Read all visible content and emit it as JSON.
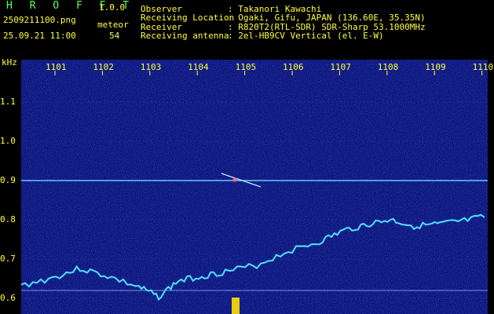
{
  "app": {
    "title": "H R O F F T",
    "version": "1.0.0",
    "filename": "2509211100.png",
    "datetime": "25.09.21 11:00",
    "meteor_label": "meteor",
    "meteor_count": "54"
  },
  "station": {
    "rows": [
      {
        "label": "Observer",
        "value": ": Takanori Kawachi"
      },
      {
        "label": "Receiving Location",
        "value": ": Ogaki, Gifu, JAPAN (136.60E, 35.35N)"
      },
      {
        "label": "Receiver",
        "value": ": R820T2(RTL-SDR) SDR-Sharp 53.1000MHz"
      },
      {
        "label": "Receiving antenna",
        "value": ": 2el-HB9CV Vertical (el. E-W)"
      }
    ]
  },
  "spectrogram": {
    "y_unit": "kHz",
    "y_ticks": [
      "1.1",
      "1.0",
      "0.9",
      "0.8",
      "0.7",
      "0.6"
    ],
    "x_ticks": [
      "1101",
      "1102",
      "1103",
      "1104",
      "1105",
      "1106",
      "1107",
      "1108",
      "1109",
      "1110"
    ],
    "colors": {
      "background": "#0a0f7a",
      "labels": "#ffff3a",
      "trace": "#35e0ff",
      "line": "#66c8ff"
    }
  }
}
